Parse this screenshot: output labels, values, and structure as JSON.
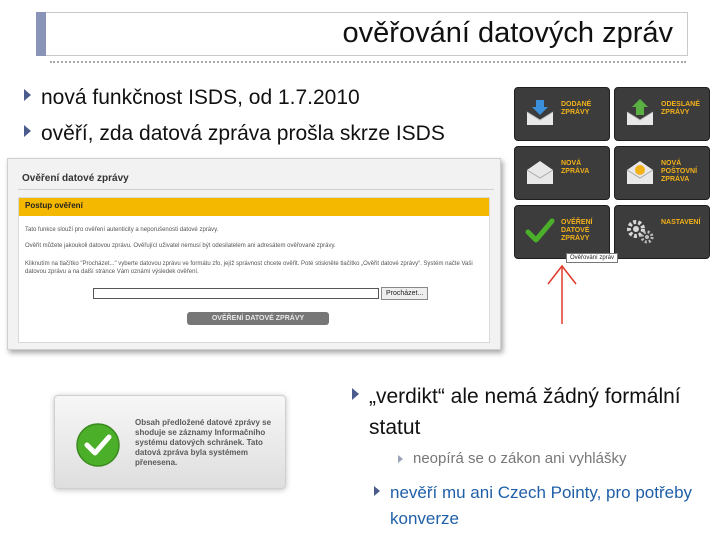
{
  "slide": {
    "title": "ověřování datových zpráv"
  },
  "bullets": {
    "b1": "nová funkčnost ISDS, od 1.7.2010",
    "b2": "ověří, zda datová zpráva prošla skrze ISDS",
    "b3": "„verdikt“ ale nemá žádný formální statut",
    "sub1": "neopírá se o zákon ani vyhlášky",
    "b4": "nevěří mu ani Czech Pointy, pro potřeby konverze"
  },
  "form": {
    "heading": "Ověření datové zprávy",
    "section": "Postup ověření",
    "p1": "Tato funkce slouží pro ověření autenticity a neporušenosti datové zprávy.",
    "p2": "Ověřit můžete jakoukoli datovou zprávu. Ověřující uživatel nemusí být odesilatelem ani adresátem ověřované zprávy.",
    "p3": "Kliknutím na tlačítko \"Procházet...\" vyberte datovou zprávu ve formátu zfo, jejíž správnost chcete ověřit. Poté stiskněte tlačítko „Ověřit datové zprávy“. Systém načte Vaši datovou zprávu a na další stránce Vám oznámí výsledek ověření.",
    "browse_label": "Procházet...",
    "verify_label": "OVĚŘENÍ DATOVÉ ZPRÁVY"
  },
  "tiles": [
    {
      "label": "DODANÉ ZPRÁVY",
      "icon": "inbox-icon"
    },
    {
      "label": "ODESLANÉ ZPRÁVY",
      "icon": "outbox-icon"
    },
    {
      "label": "NOVÁ ZPRÁVA",
      "icon": "envelope-icon"
    },
    {
      "label": "NOVÁ POŠTOVNÍ ZPRÁVA",
      "icon": "postal-envelope-icon"
    },
    {
      "label": "OVĚŘENÍ DATOVÉ ZPRÁVY",
      "icon": "checkmark-icon"
    },
    {
      "label": "NASTAVENÍ",
      "icon": "gears-icon"
    }
  ],
  "tooltip": "Ověřování zpráv",
  "result": {
    "message": "Obsah předložené datové zprávy se shoduje se záznamy Informačního systému datových schránek. Tato datová zpráva byla systémem přenesena."
  },
  "colors": {
    "accent": "#8a93b8",
    "bullet": "#4a5b8c",
    "link_blue": "#1f5fa8",
    "form_bar": "#f5b800",
    "tile_label": "#f4b21a",
    "arrow_red": "#e03a2a",
    "check_green": "#4caf2a"
  }
}
